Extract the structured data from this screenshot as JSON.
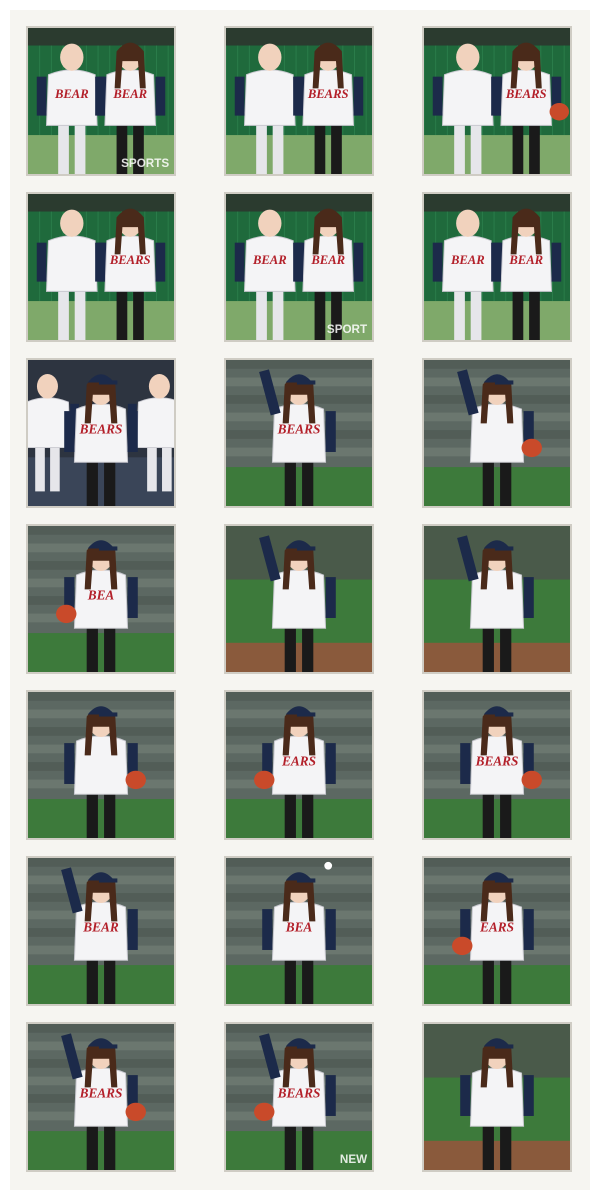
{
  "gallery": {
    "colors": {
      "page_background": "#f6f5f1",
      "thumb_border": "#cfccc4",
      "jersey_white": "#f4f4f6",
      "jersey_navy": "#1c2a4a",
      "team_red": "#b3202a",
      "field_green": "#3d7a3b",
      "cage_green": "#1f6a3c",
      "glove_red": "#c94a2a"
    },
    "photos": [
      {
        "scene": "cage",
        "subject": "coach-and-pitcher",
        "jersey_text": "BEAR",
        "watermark": "SPORTS"
      },
      {
        "scene": "cage",
        "subject": "coach-and-pitcher-standing",
        "jersey_text": "BEARS",
        "watermark": ""
      },
      {
        "scene": "cage",
        "subject": "coach-and-pitcher-glove",
        "jersey_text": "BEARS",
        "watermark": ""
      },
      {
        "scene": "cage",
        "subject": "stretch-with-coach",
        "jersey_text": "BEARS",
        "watermark": ""
      },
      {
        "scene": "cage",
        "subject": "fist-pose-duo",
        "jersey_text": "BEAR",
        "watermark": "SPORT"
      },
      {
        "scene": "cage",
        "subject": "fist-pose-duo-wide",
        "jersey_text": "BEAR",
        "watermark": ""
      },
      {
        "scene": "dugout",
        "subject": "cap-portrait-players",
        "jersey_text": "BEARS",
        "watermark": ""
      },
      {
        "scene": "stadium",
        "subject": "cap-wave",
        "jersey_text": "BEARS",
        "watermark": ""
      },
      {
        "scene": "stadium",
        "subject": "arm-raised-glove",
        "jersey_text": "",
        "watermark": ""
      },
      {
        "scene": "stadium",
        "subject": "glove-close",
        "jersey_text": "BEA",
        "watermark": ""
      },
      {
        "scene": "field",
        "subject": "windup-wide",
        "jersey_text": "",
        "watermark": ""
      },
      {
        "scene": "field",
        "subject": "windup-leg",
        "jersey_text": "",
        "watermark": ""
      },
      {
        "scene": "stadium",
        "subject": "throw-glove-front",
        "jersey_text": "",
        "watermark": ""
      },
      {
        "scene": "stadium",
        "subject": "throw-close",
        "jersey_text": "EARS",
        "watermark": ""
      },
      {
        "scene": "stadium",
        "subject": "throw-side",
        "jersey_text": "BEARS",
        "watermark": ""
      },
      {
        "scene": "stadium",
        "subject": "release-pose",
        "jersey_text": "BEAR",
        "watermark": ""
      },
      {
        "scene": "stadium",
        "subject": "hair-flip",
        "jersey_text": "BEA",
        "watermark": ""
      },
      {
        "scene": "stadium",
        "subject": "glove-ready",
        "jersey_text": "EARS",
        "watermark": ""
      },
      {
        "scene": "stadium",
        "subject": "arms-up-glove",
        "jersey_text": "BEARS",
        "watermark": ""
      },
      {
        "scene": "stadium",
        "subject": "arms-up-cheer",
        "jersey_text": "BEARS",
        "watermark": "NEW"
      },
      {
        "scene": "field",
        "subject": "mascot-hug",
        "jersey_text": "",
        "watermark": ""
      }
    ]
  }
}
